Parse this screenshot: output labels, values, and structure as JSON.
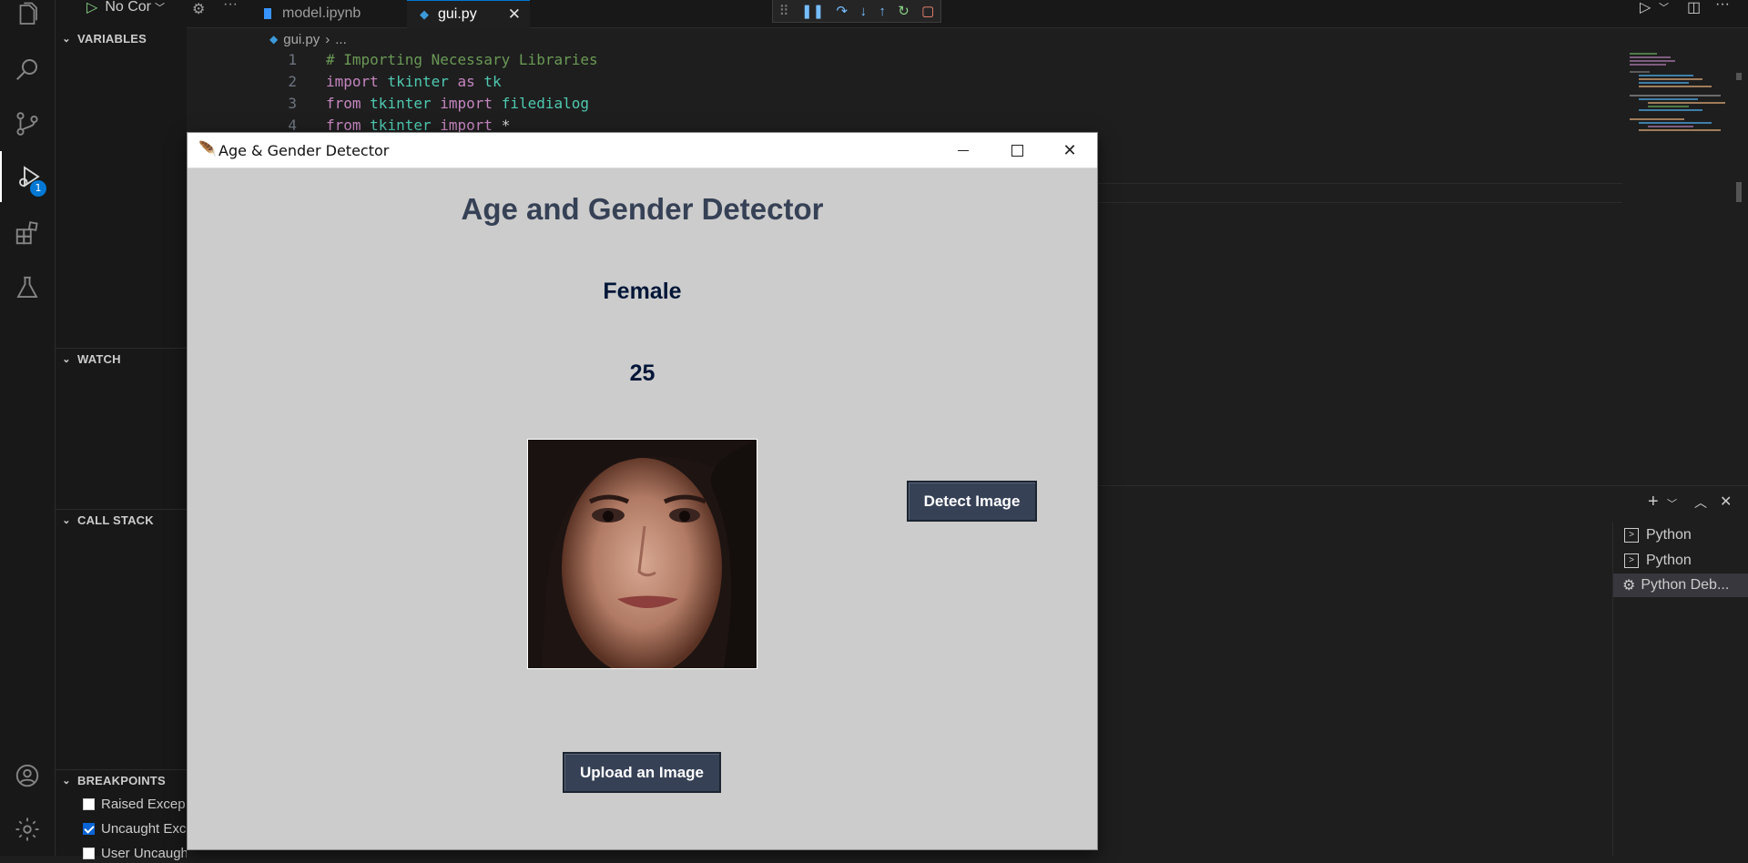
{
  "topbar": {
    "run_config": "No Cor",
    "tabs": [
      {
        "label": "model.ipynb"
      },
      {
        "label": "gui.py"
      }
    ]
  },
  "sidebar": {
    "sections": {
      "variables": "VARIABLES",
      "watch": "WATCH",
      "call_stack": "CALL STACK",
      "breakpoints": "BREAKPOINTS"
    },
    "breakpoints": [
      {
        "label": "Raised Excep",
        "checked": false
      },
      {
        "label": "Uncaught Exc",
        "checked": true
      },
      {
        "label": "User Uncaught Ex",
        "checked": false
      }
    ],
    "debug_badge": "1"
  },
  "editor": {
    "breadcrumb_file": "gui.py",
    "breadcrumb_more": "...",
    "lines": [
      {
        "n": "1"
      },
      {
        "n": "2"
      },
      {
        "n": "3"
      },
      {
        "n": "4"
      }
    ],
    "code": {
      "l1_comment": "# Importing Necessary Libraries",
      "l2_import": "import",
      "l2_mod": "tkinter",
      "l2_as": "as",
      "l2_alias": "tk",
      "l3_from": "from",
      "l3_mod": "tkinter",
      "l3_import": "import",
      "l3_name": "filedialog",
      "l4_from": "from",
      "l4_mod": "tkinter",
      "l4_import": "import",
      "l4_name": "*"
    }
  },
  "terminal_list": [
    {
      "label": "Python"
    },
    {
      "label": "Python"
    },
    {
      "label": "Python Deb..."
    }
  ],
  "dialog": {
    "window_title": "Age & Gender Detector",
    "heading": "Age and Gender Detector",
    "gender": "Female",
    "age": "25",
    "detect_button": "Detect Image",
    "upload_button": "Upload an Image"
  },
  "colors": {
    "accent": "#0078d4",
    "tk_bg": "#cccccc",
    "tk_button": "#364156",
    "heading": "#364156"
  }
}
